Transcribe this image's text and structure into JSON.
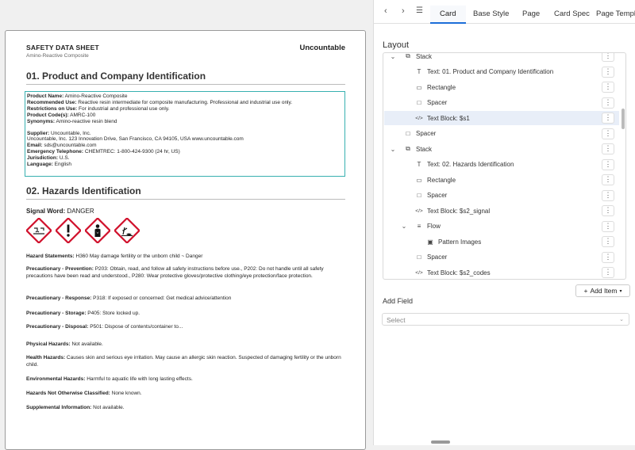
{
  "document": {
    "title": "SAFETY DATA SHEET",
    "subtitle": "Amino-Reactive Composite",
    "brand": "Uncountable",
    "section1_title": "01. Product and Company Identification",
    "section1_lines": [
      {
        "label": "Product Name:",
        "value": " Amino-Reactive Composite"
      },
      {
        "label": "Recommended Use:",
        "value": " Reactive resin intermediate for composite manufacturing. Professional and industrial use only."
      },
      {
        "label": "Restrictions on Use:",
        "value": " For industrial and professional use only."
      },
      {
        "label": "Product Code(s):",
        "value": " AMRC-100"
      },
      {
        "label": "Synonyms:",
        "value": " Amino-reactive resin blend"
      }
    ],
    "supplier_lines": [
      {
        "label": "Supplier:",
        "value": " Uncountable, Inc."
      },
      {
        "label": "",
        "value": "Uncountable, Inc. 123 Innovation Drive, San Francisco, CA 94105, USA www.uncountable.com"
      },
      {
        "label": "Email:",
        "value": " sds@uncountable.com"
      },
      {
        "label": "Emergency Telephone:",
        "value": " CHEMTREC: 1-800-424-9300 (24 hr, US)"
      },
      {
        "label": "Jurisdiction:",
        "value": " U.S."
      },
      {
        "label": "Language:",
        "value": " English"
      }
    ],
    "section2_title": "02. Hazards Identification",
    "signal_label": "Signal Word:",
    "signal_value": " DANGER",
    "pictograms": [
      "corrosion-pictogram-icon",
      "exclamation-pictogram-icon",
      "health-hazard-pictogram-icon",
      "environment-pictogram-icon"
    ],
    "hazard_lines": [
      {
        "label": "Hazard Statements:",
        "value": " H360 May damage fertility or the unborn child ~ Danger"
      },
      {
        "label": "Precautionary - Prevention:",
        "value": " P203: Obtain, read, and follow all safety instructions before use., P202: Do not handle until all safety precautions have been read and understood., P280: Wear protective gloves/protective clothing/eye protection/face protection."
      },
      {
        "label": "Precautionary - Response:",
        "value": " P318: If exposed or concerned: Get medical advice/attention"
      },
      {
        "label": "Precautionary - Storage:",
        "value": " P405: Store locked up."
      },
      {
        "label": "Precautionary - Disposal:",
        "value": " P501: Dispose of contents/container to..."
      },
      {
        "label": "Physical Hazards:",
        "value": " Not available."
      },
      {
        "label": "Health Hazards:",
        "value": " Causes skin and serious eye irritation. May cause an allergic skin reaction. Suspected of damaging fertility or the unborn child."
      },
      {
        "label": "Environmental Hazards:",
        "value": " Harmful to aquatic life with long lasting effects."
      },
      {
        "label": "Hazards Not Otherwise Classified:",
        "value": " None known."
      },
      {
        "label": "Supplemental Information:",
        "value": " Not available."
      }
    ]
  },
  "panel": {
    "tabs": [
      "Card",
      "Base Style",
      "Page",
      "Card Spec",
      "Page Templa"
    ],
    "active_tab": "Card",
    "layout_label": "Layout",
    "tree": [
      {
        "label": "Stack",
        "icon": "stack-icon",
        "depth": 0,
        "chevron": "down",
        "selected": false
      },
      {
        "label": "Text: 01. Product and Company Identification",
        "icon": "text-icon",
        "depth": 1,
        "chevron": "",
        "selected": false
      },
      {
        "label": "Rectangle",
        "icon": "rectangle-icon",
        "depth": 1,
        "chevron": "",
        "selected": false
      },
      {
        "label": "Spacer",
        "icon": "spacer-icon",
        "depth": 1,
        "chevron": "",
        "selected": false
      },
      {
        "label": "Text Block: $s1",
        "icon": "code-icon",
        "depth": 1,
        "chevron": "",
        "selected": true
      },
      {
        "label": "Spacer",
        "icon": "spacer-icon",
        "depth": 0,
        "chevron": "",
        "selected": false
      },
      {
        "label": "Stack",
        "icon": "stack-icon",
        "depth": 0,
        "chevron": "down",
        "selected": false
      },
      {
        "label": "Text: 02. Hazards Identification",
        "icon": "text-icon",
        "depth": 1,
        "chevron": "",
        "selected": false
      },
      {
        "label": "Rectangle",
        "icon": "rectangle-icon",
        "depth": 1,
        "chevron": "",
        "selected": false
      },
      {
        "label": "Spacer",
        "icon": "spacer-icon",
        "depth": 1,
        "chevron": "",
        "selected": false
      },
      {
        "label": "Text Block: $s2_signal",
        "icon": "code-icon",
        "depth": 1,
        "chevron": "",
        "selected": false
      },
      {
        "label": "Flow",
        "icon": "flow-icon",
        "depth": 1,
        "chevron": "down",
        "selected": false
      },
      {
        "label": "Pattern Images",
        "icon": "image-icon",
        "depth": 2,
        "chevron": "",
        "selected": false
      },
      {
        "label": "Spacer",
        "icon": "spacer-icon",
        "depth": 1,
        "chevron": "",
        "selected": false
      },
      {
        "label": "Text Block: $s2_codes",
        "icon": "code-icon",
        "depth": 1,
        "chevron": "",
        "selected": false
      }
    ],
    "add_item_label": "Add Item",
    "add_field_label": "Add Field",
    "select_placeholder": "Select"
  },
  "colors": {
    "accent": "#1c6ed8",
    "selection_outline": "#38b0b0",
    "selected_row": "#e8eef8",
    "ghs_red": "#d0102b"
  }
}
